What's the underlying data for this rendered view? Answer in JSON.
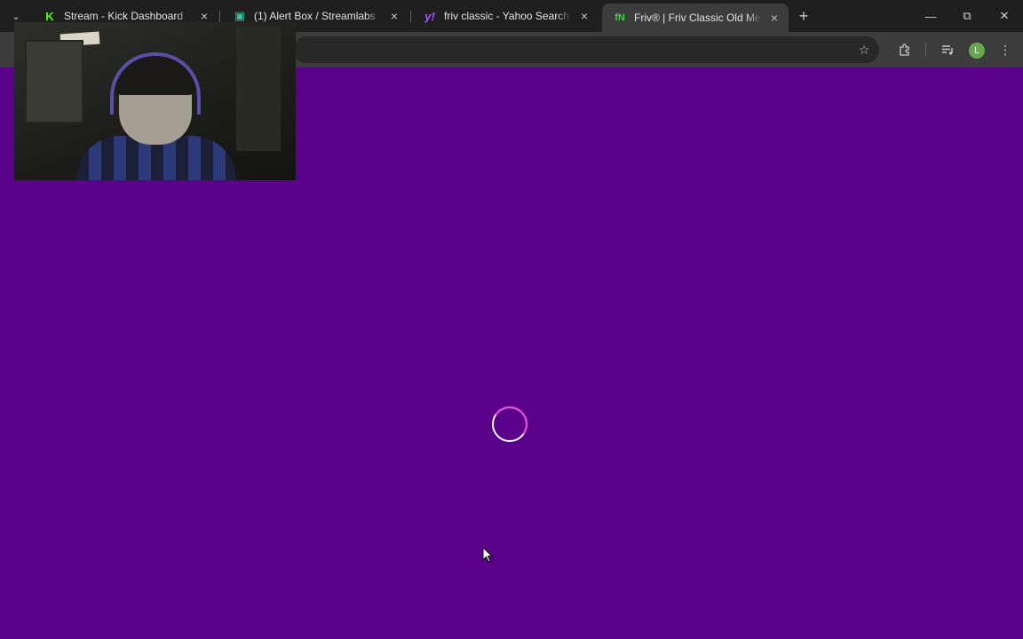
{
  "browser": {
    "tabs": [
      {
        "title": "Stream - Kick Dashboard",
        "favicon": "kick-icon",
        "favicon_color": "#53fc18",
        "active": false
      },
      {
        "title": "(1) Alert Box / Streamlabs",
        "favicon": "streamlabs-icon",
        "favicon_color": "#31c3a2",
        "active": false
      },
      {
        "title": "friv classic - Yahoo Search Tus r",
        "favicon": "yahoo-icon",
        "favicon_color": "#a259ff",
        "active": false
      },
      {
        "title": "Friv® | Friv Classic Old Menu",
        "favicon": "friv-icon",
        "favicon_color": "#3ad14a",
        "active": true
      }
    ],
    "profile_initial": "L",
    "profile_color": "#6aa84f"
  },
  "page": {
    "background_color": "#5a008a",
    "loading": true
  },
  "overlay": {
    "webcam_label": "webcam-overlay"
  },
  "icons": {
    "tab_list": "chevron-down-icon",
    "tab_close": "close-icon",
    "new_tab": "plus-icon",
    "minimize": "minimize-icon",
    "restore": "restore-icon",
    "close_window": "close-icon",
    "bookmark": "star-icon",
    "extensions": "puzzle-icon",
    "media": "media-queue-icon",
    "menu": "kebab-menu-icon"
  }
}
